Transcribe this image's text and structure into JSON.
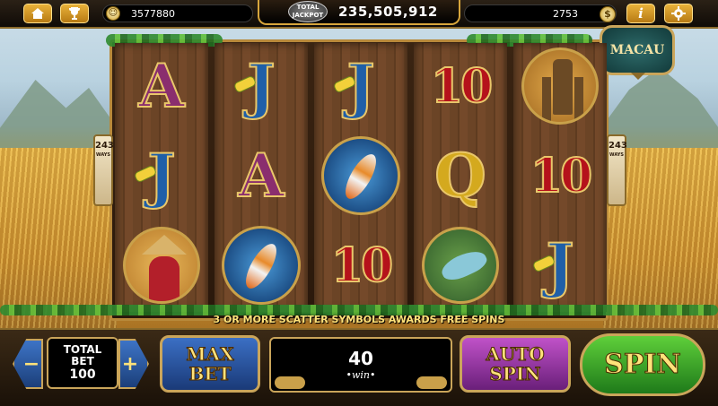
{
  "topbar": {
    "home_icon": "home-icon",
    "trophy_icon": "trophy-icon",
    "balance": "3577880",
    "jackpot_logo_line1": "TOTAL",
    "jackpot_logo_line2": "JACKPOT",
    "jackpot_value": "235,505,912",
    "coins": "2753",
    "coin_symbol": "$",
    "info_label": "i",
    "settings_icon": "gear-icon"
  },
  "game": {
    "badge": "MACAU",
    "ways_left": {
      "top": "243",
      "bottom": "WAYS"
    },
    "ways_right": {
      "top": "243",
      "bottom": "WAYS"
    },
    "reels": [
      [
        {
          "type": "letter",
          "value": "A"
        },
        {
          "type": "letter",
          "value": "J"
        },
        {
          "type": "image",
          "value": "girl"
        }
      ],
      [
        {
          "type": "letter",
          "value": "J"
        },
        {
          "type": "letter",
          "value": "A"
        },
        {
          "type": "image",
          "value": "koi"
        }
      ],
      [
        {
          "type": "letter",
          "value": "J"
        },
        {
          "type": "image",
          "value": "koi"
        },
        {
          "type": "number",
          "value": "10"
        }
      ],
      [
        {
          "type": "number",
          "value": "10"
        },
        {
          "type": "letter",
          "value": "Q"
        },
        {
          "type": "image",
          "value": "bird"
        }
      ],
      [
        {
          "type": "image",
          "value": "scarecrow"
        },
        {
          "type": "number",
          "value": "10"
        },
        {
          "type": "letter",
          "value": "J"
        }
      ]
    ],
    "scatter_text": "3 OR MORE SCATTER SYMBOLS AWARDS FREE SPINS"
  },
  "controls": {
    "minus_label": "−",
    "plus_label": "+",
    "total_bet_label_1": "TOTAL",
    "total_bet_label_2": "BET",
    "total_bet_value": "100",
    "max_bet_line1": "MAX",
    "max_bet_line2": "BET",
    "win_value": "40",
    "win_label": "•win•",
    "auto_spin_line1": "AUTO",
    "auto_spin_line2": "SPIN",
    "spin_label": "SPIN"
  },
  "colors": {
    "gold": "#caa55a",
    "spin_green": "#1f7a1a",
    "max_bet_blue": "#1a3a78",
    "auto_purple": "#6a1f7a"
  }
}
